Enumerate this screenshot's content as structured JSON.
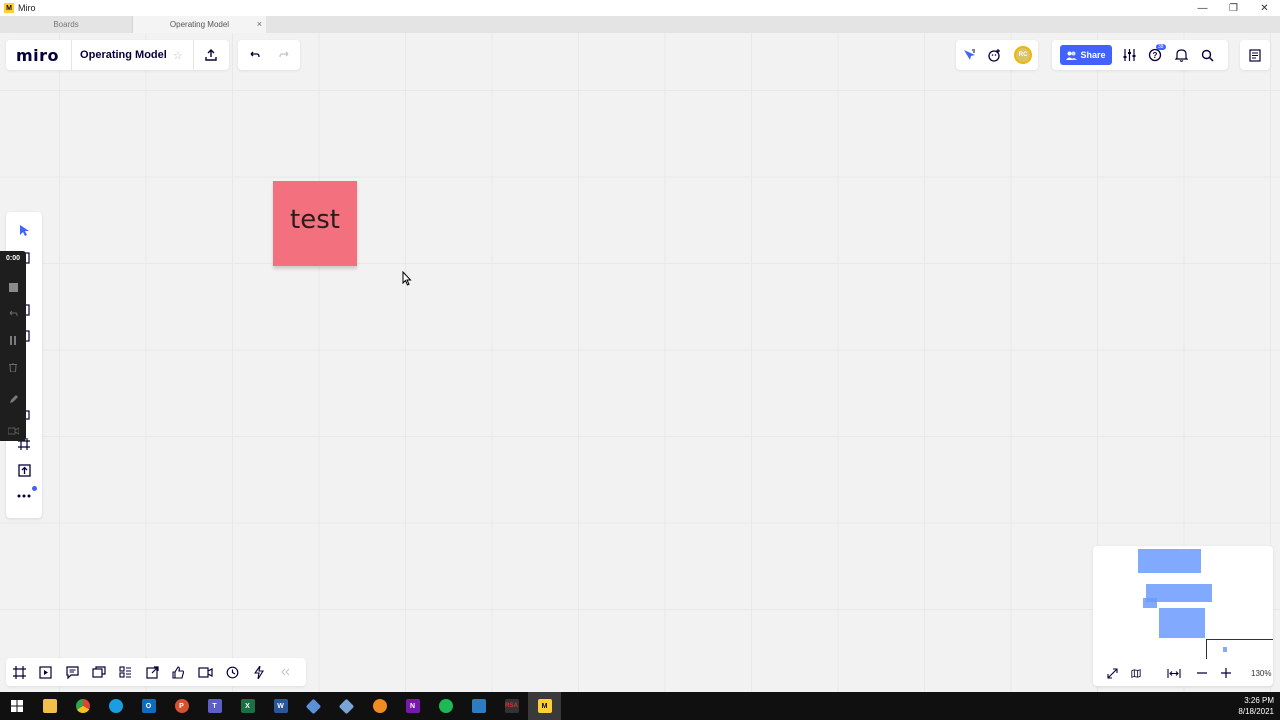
{
  "window": {
    "title": "Miro",
    "controls": {
      "minimize": "—",
      "restore": "❐",
      "close": "✕"
    }
  },
  "tabs": [
    {
      "label": "Boards"
    },
    {
      "label": "Operating Model",
      "close": "×"
    }
  ],
  "header": {
    "logo": "miro",
    "board_name": "Operating Model",
    "share_label": "Share",
    "avatar_initials": "RC",
    "help_badge": "38"
  },
  "recorder": {
    "time": "0:00"
  },
  "sticky_note": {
    "text": "test",
    "color": "#f3707e"
  },
  "minimap": {
    "zoom": "130%"
  },
  "taskbar": {
    "time": "3:26 PM",
    "date": "8/18/2021"
  },
  "colors": {
    "accent": "#4262ff",
    "canvas": "#f2f2f2",
    "minimap_blocks": "#6b9bff"
  }
}
